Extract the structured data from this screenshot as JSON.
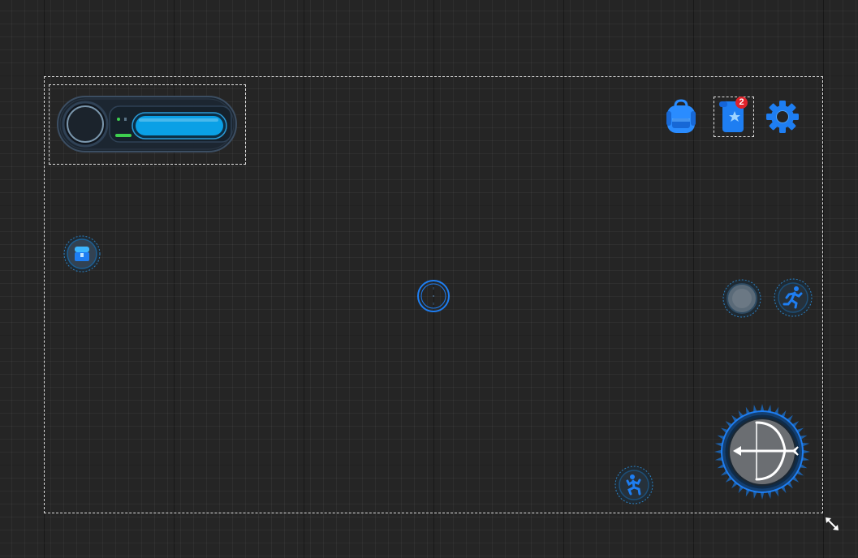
{
  "hud": {
    "portrait": "player-portrait",
    "health_fraction": 1.0,
    "energy_fraction": 0.3
  },
  "top_right": {
    "inventory_icon": "backpack-icon",
    "quest_icon": "quest-scroll-icon",
    "quest_badge": "2",
    "settings_icon": "gear-icon"
  },
  "left_button_icon": "chest-icon",
  "crosshair_icon": "crosshair-icon",
  "right_buttons": [
    "locked-skill-icon",
    "sprint-icon"
  ],
  "bottom_buttons": [
    "crouch-icon",
    "bow-attack-icon"
  ],
  "resize_icon": "expand-arrows-icon",
  "colors": {
    "accent": "#1e7ef2",
    "bar_fill": "#0aa0e6",
    "energy": "#3ecf4f",
    "badge": "#e0232b",
    "background": "#252525"
  }
}
